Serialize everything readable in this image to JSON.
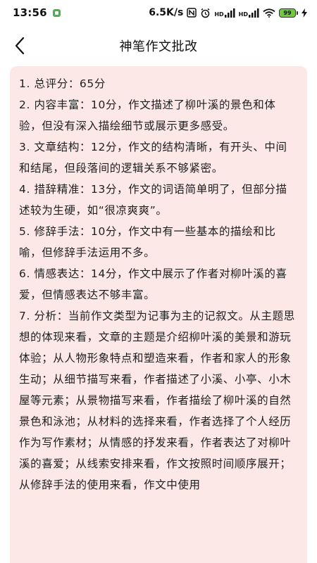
{
  "status_bar": {
    "time": "13:56",
    "network_speed": "6.5K/s",
    "signal_1_label": "HD",
    "signal_2_label": "HD",
    "battery_level": "99"
  },
  "header": {
    "title": "神笔作文批改"
  },
  "result": {
    "items": [
      "1. 总评分：65分",
      "2. 内容丰富：10分，作文描述了柳叶溪的景色和体验，但没有深入描绘细节或展示更多感受。",
      "3. 文章结构：12分，作文的结构清晰，有开头、中间和结尾，但段落间的逻辑关系不够紧密。",
      "4. 措辞精准：13分，作文的词语简单明了，但部分描述较为生硬，如“很凉爽爽”。",
      "5. 修辞手法：10分，作文中有一些基本的描绘和比喻，但修辞手法运用不多。",
      "6. 情感表达：14分，作文中展示了作者对柳叶溪的喜爱，但情感表达不够丰富。",
      "7. 分析：当前作文类型为记事为主的记叙文。从主题思想的体现来看，文章的主题是介绍柳叶溪的美景和游玩体验；从人物形象特点和塑造来看，作者和家人的形象生动；从细节描写来看，作者描述了小溪、小亭、小木屋等元素；从景物描写来看，作者描绘了柳叶溪的自然景色和泳池；从材料的选择来看，作者选择了个人经历作为写作素材；从情感的抒发来看，作者表达了对柳叶溪的喜爱；从线索安排来看，作文按照时间顺序展开；从修辞手法的使用来看，作文中使用"
    ]
  }
}
